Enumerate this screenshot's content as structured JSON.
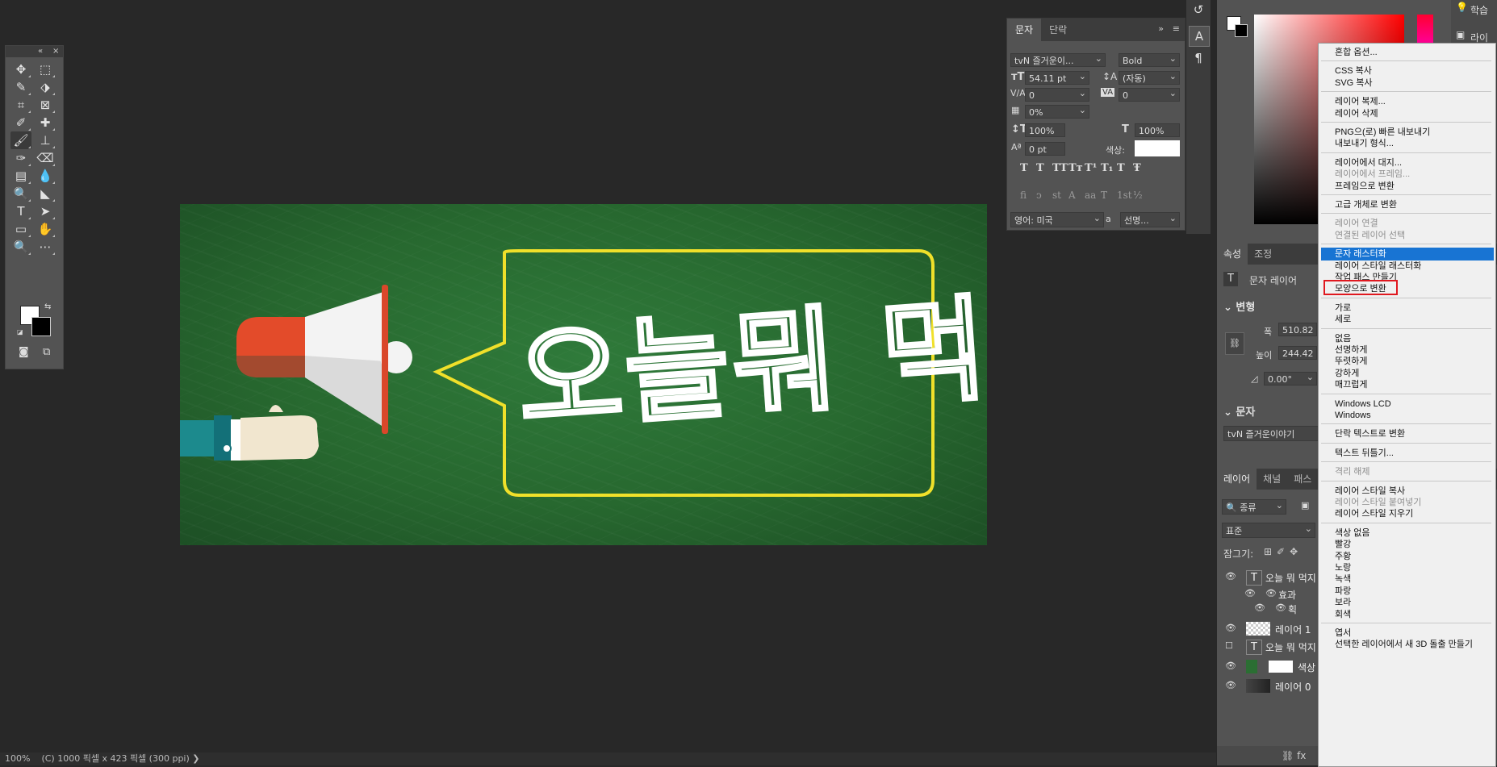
{
  "colors": {
    "canvas_bg": "#282828",
    "panel": "#535353",
    "accent": "#1874d3",
    "chalk_yellow": "#f0e02a",
    "board_green": "#2b6e33"
  },
  "tools": {
    "rows": [
      [
        "move-icon",
        "marquee-icon"
      ],
      [
        "quick-select-icon",
        "object-select-icon"
      ],
      [
        "crop-icon",
        "frame-icon"
      ],
      [
        "eyedropper-icon",
        "healing-icon"
      ],
      [
        "brush-icon",
        "stamp-icon"
      ],
      [
        "history-brush-icon",
        "eraser-icon"
      ],
      [
        "gradient-icon",
        "blur-icon"
      ],
      [
        "dodge-icon",
        "pen-icon"
      ],
      [
        "type-icon",
        "path-select-icon"
      ],
      [
        "shape-icon",
        "hand-icon"
      ],
      [
        "zoom-icon",
        "more-icon"
      ]
    ],
    "glyphs": [
      [
        "✥",
        "⬚"
      ],
      [
        "✎",
        "⬗"
      ],
      [
        "⌗",
        "⊠"
      ],
      [
        "✐",
        "✚"
      ],
      [
        "🖌",
        "⊥"
      ],
      [
        "✑",
        "⌫"
      ],
      [
        "▤",
        "💧"
      ],
      [
        "🔍",
        "◣"
      ],
      [
        "T",
        "➤"
      ],
      [
        "▭",
        "✋"
      ],
      [
        "🔍",
        "⋯"
      ]
    ]
  },
  "canvas": {
    "headline": "오늘뭐 먹지"
  },
  "char_panel": {
    "tabs": [
      "문자",
      "단락"
    ],
    "font_family": "tvN 즐거운이...",
    "font_style": "Bold",
    "font_size": "54.11 pt",
    "leading": "(자동)",
    "kerning": "0",
    "tracking": "0",
    "tsume": "0%",
    "vscale": "100%",
    "hscale": "100%",
    "baseline": "0 pt",
    "color_label": "색상:",
    "language": "영어: 미국",
    "antialias_label": "a",
    "antialias": "선명...",
    "style_buttons": [
      "T",
      "T",
      "TT",
      "Tт",
      "T¹",
      "T₁",
      "T",
      "Ŧ"
    ],
    "ot_buttons": [
      "fi",
      "ↄ",
      "st",
      "A",
      "aa",
      "T",
      "1st",
      "½"
    ]
  },
  "properties": {
    "tabs": [
      "속성",
      "조정"
    ],
    "layer_type": "문자 레이어",
    "transform_title": "변형",
    "width_label": "폭",
    "width": "510.82",
    "height_label": "높이",
    "height": "244.42",
    "angle": "0.00°",
    "char_title": "문자",
    "font": "tvN 즐거운이야기"
  },
  "layers": {
    "tabs": [
      "레이어",
      "채널",
      "패스"
    ],
    "filter": "종류",
    "blend": "표준",
    "lock_label": "잠그기:",
    "items": [
      {
        "name": "오늘 뭐 먹지",
        "visible": true
      },
      {
        "name": "효과",
        "visible": true
      },
      {
        "name": "획",
        "visible": true
      },
      {
        "name": "레이어 1",
        "visible": true
      },
      {
        "name": "오늘 뭐 먹지",
        "visible": false
      },
      {
        "name": "색상",
        "visible": true
      },
      {
        "name": "레이어 0",
        "visible": true
      }
    ]
  },
  "right_top": {
    "learn": "학습",
    "library": "라이브"
  },
  "context_menu": {
    "items": [
      {
        "label": "혼합 옵션...",
        "dis": false
      },
      {
        "sep": true
      },
      {
        "label": "CSS 복사",
        "dis": false
      },
      {
        "label": "SVG 복사",
        "dis": false
      },
      {
        "sep": true
      },
      {
        "label": "레이어 복제...",
        "dis": false
      },
      {
        "label": "레이어 삭제",
        "dis": false
      },
      {
        "sep": true
      },
      {
        "label": "PNG으(로) 빠른 내보내기",
        "dis": false
      },
      {
        "label": "내보내기 형식...",
        "dis": false
      },
      {
        "sep": true
      },
      {
        "label": "레이어에서 대지...",
        "dis": false
      },
      {
        "label": "레이어에서 프레임...",
        "dis": true
      },
      {
        "label": "프레임으로 변환",
        "dis": false
      },
      {
        "sep": true
      },
      {
        "label": "고급 개체로 변환",
        "dis": false
      },
      {
        "sep": true
      },
      {
        "label": "레이어 연결",
        "dis": true
      },
      {
        "label": "연결된 레이어 선택",
        "dis": true
      },
      {
        "sep": true
      },
      {
        "label": "문자 래스터화",
        "dis": false,
        "hl": true
      },
      {
        "label": "레이어 스타일 래스터화",
        "dis": false
      },
      {
        "label": "작업 패스 만들기",
        "dis": false
      },
      {
        "label": "모양으로 변환",
        "dis": false
      },
      {
        "sep": true
      },
      {
        "label": "가로",
        "dis": false
      },
      {
        "label": "세로",
        "dis": false
      },
      {
        "sep": true
      },
      {
        "label": "없음",
        "dis": false
      },
      {
        "label": "선명하게",
        "dis": false
      },
      {
        "label": "뚜렷하게",
        "dis": false
      },
      {
        "label": "강하게",
        "dis": false
      },
      {
        "label": "매끄럽게",
        "dis": false
      },
      {
        "sep": true
      },
      {
        "label": "Windows LCD",
        "dis": false
      },
      {
        "label": "Windows",
        "dis": false
      },
      {
        "sep": true
      },
      {
        "label": "단락 텍스트로 변환",
        "dis": false
      },
      {
        "sep": true
      },
      {
        "label": "텍스트 뒤틀기...",
        "dis": false
      },
      {
        "sep": true
      },
      {
        "label": "격리 해제",
        "dis": true
      },
      {
        "sep": true
      },
      {
        "label": "레이어 스타일 복사",
        "dis": false
      },
      {
        "label": "레이어 스타일 붙여넣기",
        "dis": true
      },
      {
        "label": "레이어 스타일 지우기",
        "dis": false
      },
      {
        "sep": true
      },
      {
        "label": "색상 없음",
        "dis": false
      },
      {
        "label": "빨강",
        "dis": false
      },
      {
        "label": "주황",
        "dis": false
      },
      {
        "label": "노랑",
        "dis": false
      },
      {
        "label": "녹색",
        "dis": false
      },
      {
        "label": "파랑",
        "dis": false
      },
      {
        "label": "보라",
        "dis": false
      },
      {
        "label": "회색",
        "dis": false
      },
      {
        "sep": true
      },
      {
        "label": "엽서",
        "dis": false
      },
      {
        "label": "선택한 레이어에서 새 3D 돌출 만들기",
        "dis": false
      }
    ]
  },
  "status": {
    "zoom": "100%",
    "doc": "(C) 1000 픽셀 x 423 픽셀 (300 ppi)",
    "arrow": "❯"
  }
}
